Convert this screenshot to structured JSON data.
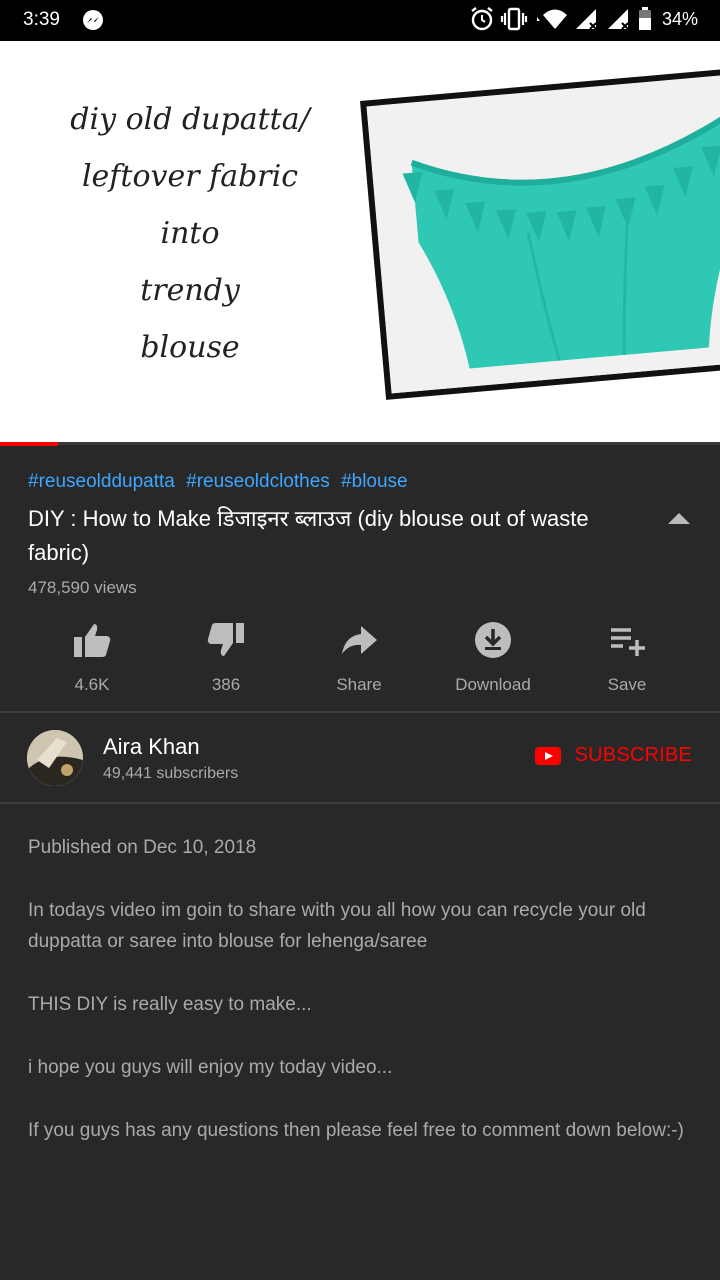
{
  "status_bar": {
    "time": "3:39",
    "battery": "34%",
    "icons": [
      "messenger-icon",
      "alarm-icon",
      "vibrate-icon",
      "wifi-icon",
      "signal-icon",
      "signal-icon",
      "battery-icon"
    ]
  },
  "video": {
    "thumbnail_text": [
      "diy old dupatta/",
      "leftover fabric",
      "into",
      "trendy",
      "blouse"
    ],
    "progress": 0.08,
    "hashtags": [
      "#reuseolddupatta",
      "#reuseoldclothes",
      "#blouse"
    ],
    "title": "DIY : How to Make डिजाइनर ब्लाउज  (diy blouse out of waste fabric)",
    "views": "478,590 views"
  },
  "actions": {
    "like": "4.6K",
    "dislike": "386",
    "share": "Share",
    "download": "Download",
    "save": "Save"
  },
  "channel": {
    "name": "Aira Khan",
    "subscribers": "49,441 subscribers",
    "subscribe_label": "SUBSCRIBE"
  },
  "description": {
    "published": "Published on Dec 10, 2018",
    "paragraphs": [
      "In todays video im goin to share with you all how you can recycle your old duppatta or saree into blouse for lehenga/saree",
      "THIS DIY is really easy to make...",
      "i hope you guys will enjoy my today video...",
      "If you guys has any questions then please feel free to comment down below:-)"
    ]
  },
  "colors": {
    "background": "#282828",
    "link": "#3ea6ff",
    "accent_red": "#ff0000",
    "secondary_text": "#aaaaaa"
  }
}
